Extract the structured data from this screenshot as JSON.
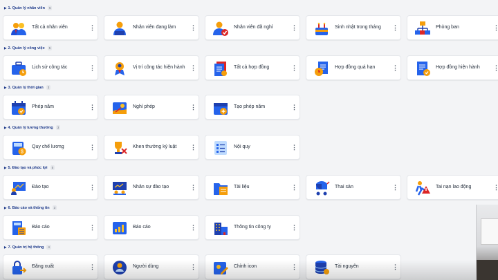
{
  "sections": [
    {
      "title": "1. Quản lý nhân viên",
      "count": "5",
      "items": [
        {
          "label": "Tất cả nhân viên",
          "icon": "employees-group-icon"
        },
        {
          "label": "Nhân viên đang làm",
          "icon": "employee-working-icon"
        },
        {
          "label": "Nhân viên đã nghỉ",
          "icon": "employee-resigned-icon"
        },
        {
          "label": "Sinh nhật trong tháng",
          "icon": "birthday-cake-icon"
        },
        {
          "label": "Phòng ban",
          "icon": "department-org-icon"
        }
      ]
    },
    {
      "title": "2. Quản lý công việc",
      "count": "5",
      "items": [
        {
          "label": "Lịch sử công tác",
          "icon": "briefcase-history-icon"
        },
        {
          "label": "Vị trí công tác hiện hành",
          "icon": "position-badge-icon"
        },
        {
          "label": "Tất cả hợp đồng",
          "icon": "contracts-stack-icon"
        },
        {
          "label": "Hợp đồng quá hạn",
          "icon": "contract-expired-icon"
        },
        {
          "label": "Hợp đồng hiện hành",
          "icon": "contract-active-icon"
        }
      ]
    },
    {
      "title": "3. Quản lý thời gian",
      "count": "3",
      "items": [
        {
          "label": "Phép năm",
          "icon": "calendar-check-icon"
        },
        {
          "label": "Nghỉ phép",
          "icon": "leave-beach-icon"
        },
        {
          "label": "Tạo phép năm",
          "icon": "calendar-add-icon"
        }
      ]
    },
    {
      "title": "4. Quản lý lương thưởng",
      "count": "3",
      "items": [
        {
          "label": "Quy chế lương",
          "icon": "salary-calculator-icon"
        },
        {
          "label": "Khen thưởng kỷ luật",
          "icon": "trophy-discipline-icon"
        },
        {
          "label": "Nội quy",
          "icon": "rules-checklist-icon"
        }
      ]
    },
    {
      "title": "5. Đào tạo và phúc lợi",
      "count": "5",
      "items": [
        {
          "label": "Đào tạo",
          "icon": "training-board-icon"
        },
        {
          "label": "Nhân sự đào tạo",
          "icon": "training-staff-icon"
        },
        {
          "label": "Tài liệu",
          "icon": "documents-folder-icon"
        },
        {
          "label": "Thai sản",
          "icon": "maternity-stroller-icon"
        },
        {
          "label": "Tai nạn lao động",
          "icon": "work-accident-icon"
        }
      ]
    },
    {
      "title": "6. Báo cáo và thống tin",
      "count": "3",
      "items": [
        {
          "label": "Báo cáo",
          "icon": "report-calculator-icon"
        },
        {
          "label": "Báo cáo",
          "icon": "report-chart-icon"
        },
        {
          "label": "Thông tin công ty",
          "icon": "company-building-icon"
        }
      ]
    },
    {
      "title": "7. Quản trị hệ thống",
      "count": "4",
      "items": [
        {
          "label": "Đăng xuất",
          "icon": "logout-lock-icon"
        },
        {
          "label": "Người dùng",
          "icon": "user-account-icon"
        },
        {
          "label": "Chỉnh icon",
          "icon": "edit-icon-icon"
        },
        {
          "label": "Tài nguyên",
          "icon": "resources-database-icon"
        }
      ]
    }
  ],
  "menu_glyph": "⋮",
  "colors": {
    "accent": "#1e3a8a",
    "icon_blue": "#2563eb",
    "icon_orange": "#f59e0b",
    "icon_red": "#dc2626"
  }
}
